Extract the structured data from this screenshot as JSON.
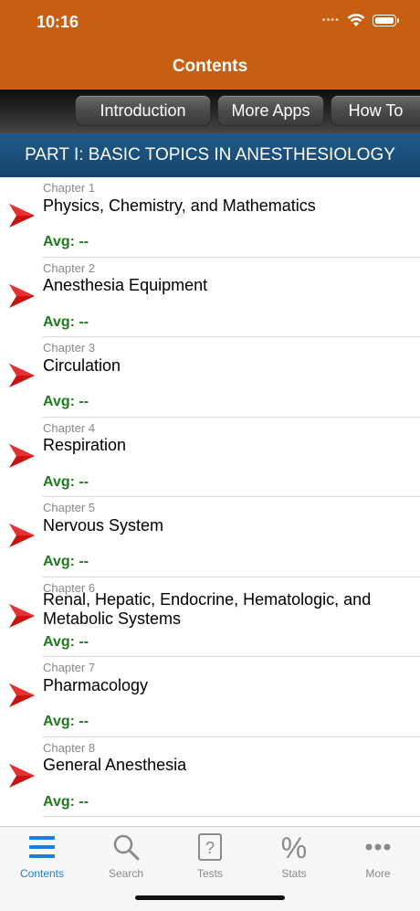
{
  "status_bar": {
    "time": "10:16"
  },
  "nav": {
    "title": "Contents"
  },
  "toolbar": {
    "buttons": [
      "Introduction",
      "More Apps",
      "How To"
    ]
  },
  "section": {
    "title": "PART I: BASIC TOPICS IN ANESTHESIOLOGY"
  },
  "chapters": [
    {
      "label": "Chapter 1",
      "title": "Physics, Chemistry, and Mathematics",
      "avg": "Avg: --"
    },
    {
      "label": "Chapter 2",
      "title": "Anesthesia Equipment",
      "avg": "Avg: --"
    },
    {
      "label": "Chapter 3",
      "title": "Circulation",
      "avg": "Avg: --"
    },
    {
      "label": "Chapter 4",
      "title": "Respiration",
      "avg": "Avg: --"
    },
    {
      "label": "Chapter 5",
      "title": "Nervous System",
      "avg": "Avg: --"
    },
    {
      "label": "Chapter 6",
      "title": "Renal, Hepatic, Endocrine, Hematologic, and Metabolic Systems",
      "avg": "Avg: --"
    },
    {
      "label": "Chapter 7",
      "title": "Pharmacology",
      "avg": "Avg: --"
    },
    {
      "label": "Chapter 8",
      "title": "General Anesthesia",
      "avg": "Avg: --"
    }
  ],
  "tabs": [
    {
      "label": "Contents",
      "icon": "list-icon",
      "active": true
    },
    {
      "label": "Search",
      "icon": "search-icon",
      "active": false
    },
    {
      "label": "Tests",
      "icon": "question-page-icon",
      "active": false
    },
    {
      "label": "Stats",
      "icon": "percent-icon",
      "active": false
    },
    {
      "label": "More",
      "icon": "more-dots-icon",
      "active": false
    }
  ],
  "colors": {
    "header": "#c75f12",
    "section": "#1f5a8a",
    "avg_text": "#1d7a1d",
    "arrow": "#cc1111",
    "tab_active": "#1a7fd6"
  }
}
